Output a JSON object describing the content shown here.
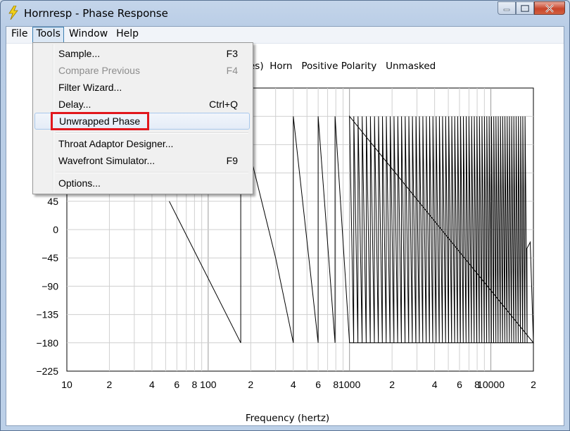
{
  "window": {
    "title": "Hornresp - Phase Response",
    "controls": [
      "minimize",
      "maximize",
      "close"
    ]
  },
  "menubar": {
    "items": [
      {
        "label": "File"
      },
      {
        "label": "Tools",
        "active": true
      },
      {
        "label": "Window"
      },
      {
        "label": "Help"
      }
    ]
  },
  "tools_menu": {
    "items": [
      {
        "label": "Sample...",
        "shortcut": "F3",
        "enabled": true
      },
      {
        "label": "Compare Previous",
        "shortcut": "F4",
        "enabled": false
      },
      {
        "label": "Filter Wizard...",
        "shortcut": "",
        "enabled": true
      },
      {
        "label": "Delay...",
        "shortcut": "Ctrl+Q",
        "enabled": true
      },
      {
        "label": "Unwrapped Phase",
        "shortcut": "",
        "enabled": true,
        "hover": true,
        "highlighted": true
      },
      {
        "label": "Throat Adaptor Designer...",
        "shortcut": "",
        "enabled": true
      },
      {
        "label": "Wavefront Simulator...",
        "shortcut": "F9",
        "enabled": true
      },
      {
        "label": "Options...",
        "shortcut": "",
        "enabled": true
      }
    ],
    "highlight_color": "#e1171e"
  },
  "chart_header": {
    "visible_fragment": "es)",
    "mode": "Horn",
    "polarity": "Positive Polarity",
    "mask": "Unmasked"
  },
  "chart_data": {
    "type": "line",
    "title": "",
    "xlabel": "Frequency (hertz)",
    "ylabel": "",
    "x_scale": "log",
    "xlim": [
      10,
      20000
    ],
    "ylim": [
      -225,
      225
    ],
    "x_tick_labels": [
      "10",
      "2",
      "4",
      "6",
      "8",
      "100",
      "2",
      "4",
      "6",
      "8",
      "1000",
      "2",
      "4",
      "6",
      "8",
      "10000",
      "2"
    ],
    "y_tick_labels": [
      "45",
      "0",
      "−45",
      "−90",
      "−135",
      "−180",
      "−225"
    ],
    "grid": true,
    "series": [
      {
        "note_visible": false,
        "x": [
          53,
          170,
          170,
          300,
          400,
          400,
          600,
          600,
          790,
          790,
          1000,
          20000
        ],
        "y": [
          45,
          -180,
          180,
          -45,
          -180,
          180,
          -180,
          180,
          -180,
          180,
          -180,
          -180
        ]
      }
    ]
  }
}
